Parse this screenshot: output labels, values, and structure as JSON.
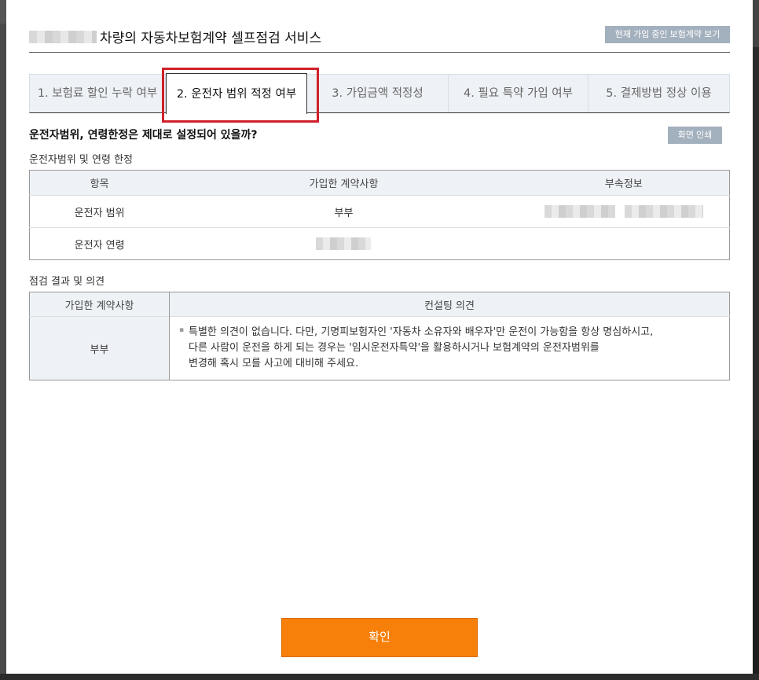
{
  "title_suffix": "차량의 자동차보험계약 셀프점검 서비스",
  "btn_current_contract": "현재 가입 중인 보험계약 보기",
  "tabs": [
    {
      "label": "1. 보험료 할인 누락 여부"
    },
    {
      "label": "2. 운전자 범위 적정 여부"
    },
    {
      "label": "3. 가입금액 적정성"
    },
    {
      "label": "4. 필요 특약 가입 여부"
    },
    {
      "label": "5. 결제방법 정상 이용"
    }
  ],
  "question": "운전자범위, 연령한정은 제대로 설정되어 있을까?",
  "btn_print": "화면 인쇄",
  "section1": {
    "label": "운전자범위 및 연령 한정",
    "headers": [
      "항목",
      "가입한 계약사항",
      "부속정보"
    ],
    "rows": [
      {
        "item": "운전자 범위",
        "value": "부부"
      },
      {
        "item": "운전자 연령"
      }
    ]
  },
  "section2": {
    "label": "점검 결과 및 의견",
    "headers": [
      "가입한 계약사항",
      "컨설팅 의견"
    ],
    "contract": "부부",
    "bullet": "▪",
    "opinion_lines": [
      "특별한 의견이 없습니다. 다만, 기명피보험자인 '자동차 소유자와 배우자'만 운전이 가능함을 항상 명심하시고,",
      "다른 사람이 운전을 하게 되는 경우는 '임시운전자특약'을 활용하시거나 보험계약의 운전자범위를",
      "변경해 혹시 모를 사고에 대비해 주세요."
    ]
  },
  "btn_confirm": "확인",
  "colors": {
    "accent": "#f7800a",
    "highlight": "#d0202a",
    "gray_button": "#a3b0be"
  }
}
